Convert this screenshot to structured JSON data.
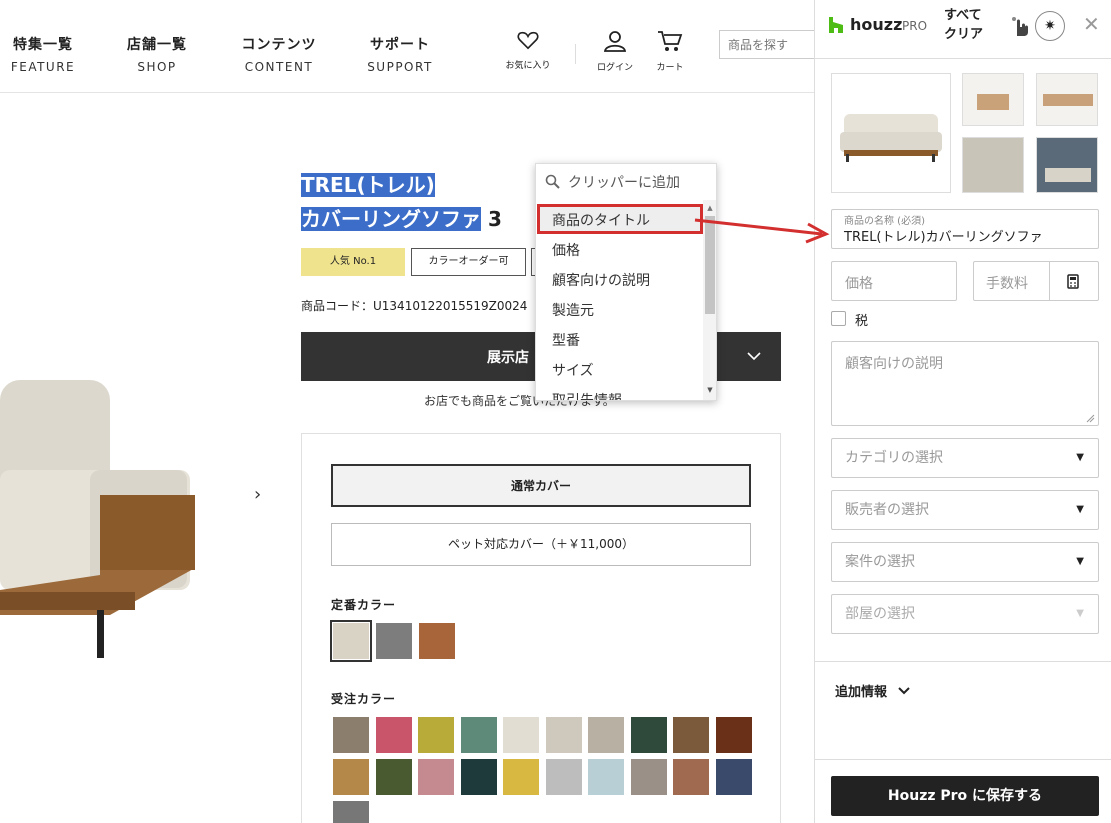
{
  "header": {
    "nav": [
      {
        "jp": "特集一覧",
        "en": "FEATURE"
      },
      {
        "jp": "店舗一覧",
        "en": "SHOP"
      },
      {
        "jp": "コンテンツ",
        "en": "CONTENT"
      },
      {
        "jp": "サポート",
        "en": "SUPPORT"
      }
    ],
    "icons": [
      {
        "icon": "heart-icon",
        "label": "お気に入り"
      },
      {
        "icon": "user-icon",
        "label": "ログイン"
      },
      {
        "icon": "cart-icon",
        "label": "カート"
      }
    ],
    "search_placeholder": "商品を探す"
  },
  "product": {
    "title_line1": "TREL(トレル)",
    "title_line2_selected": "カバーリングソファ",
    "title_line2_rest": " 3",
    "badges": [
      "人気 No.1",
      "カラーオーダー可"
    ],
    "code": "商品コード：U13410122015519Z0024",
    "display_button": "展示店",
    "store_note": "お店でも商品をご覧いただけます。",
    "options": [
      "通常カバー",
      "ペット対応カバー（＋￥11,000）"
    ],
    "standard_color_label": "定番カラー",
    "order_color_label": "受注カラー",
    "standard_colors": [
      "#d8d3c4",
      "#7d7d7d",
      "#a8653a"
    ],
    "order_colors": [
      "#8c7e6d",
      "#c8556a",
      "#b9ab3a",
      "#5e8a7a",
      "#e2ddd3",
      "#cfc9bd",
      "#b7b0a3",
      "#2f4a3a",
      "#7a5a3a",
      "#6a3018",
      "#b48848",
      "#4a5a30",
      "#c48a90",
      "#1f3a3a",
      "#d8b840",
      "#bdbdbd",
      "#b7cfd5",
      "#9a9088",
      "#a06a50",
      "#3a4a6a",
      "#777777"
    ]
  },
  "dropdown": {
    "header": "クリッパーに追加",
    "items": [
      "商品のタイトル",
      "価格",
      "顧客向けの説明",
      "製造元",
      "型番",
      "サイズ",
      "取引先情報"
    ]
  },
  "houzz": {
    "brand": "houzz",
    "brand_suffix": "PRO",
    "clear_line1": "すべて",
    "clear_line2": "クリア",
    "name_label": "商品の名称 (必須)",
    "name_value": "TREL(トレル)カバーリングソファ",
    "price_placeholder": "価格",
    "fee_placeholder": "手数料",
    "tax_label": "税",
    "desc_placeholder": "顧客向けの説明",
    "selects": [
      "カテゴリの選択",
      "販売者の選択",
      "案件の選択",
      "部屋の選択"
    ],
    "more_info": "追加情報",
    "save_button": "Houzz Pro に保存する",
    "accent": "#4dbc15"
  }
}
